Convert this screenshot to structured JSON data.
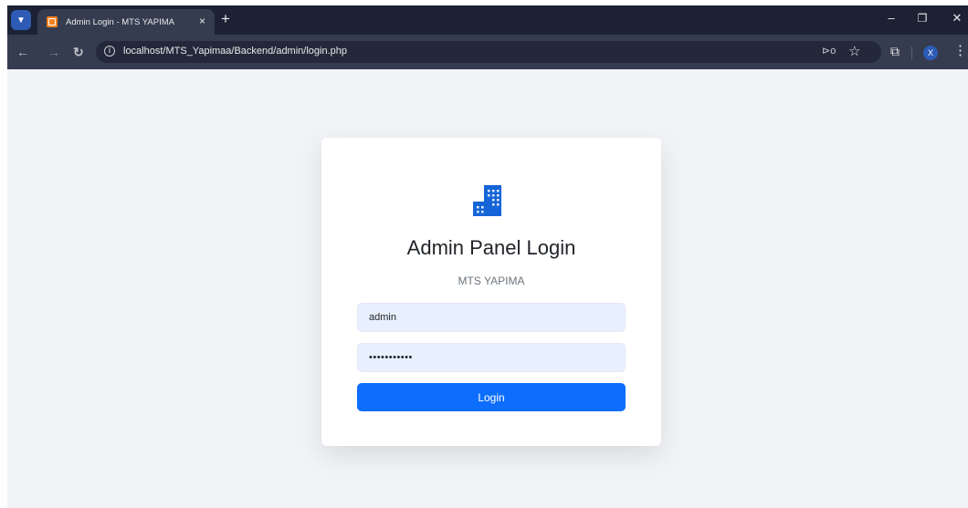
{
  "browser": {
    "tab_title": "Admin Login - MTS YAPIMA",
    "tab_close": "×",
    "new_tab": "+",
    "url": "localhost/MTS_Yapimaa/Backend/admin/login.php",
    "profile_initial": "X",
    "window_controls": {
      "minimize": "–",
      "maximize": "❐",
      "close": "✕"
    },
    "icons": [
      "tab-search-icon",
      "favicon-icon",
      "back-icon",
      "forward-icon",
      "reload-icon",
      "site-info-icon",
      "password-key-icon",
      "bookmark-star-icon",
      "extensions-icon",
      "menu-icon"
    ]
  },
  "login": {
    "heading": "Admin Panel Login",
    "subheading": "MTS YAPIMA",
    "username_value": "admin",
    "password_value": "admin123456",
    "button_label": "Login",
    "logo_icon": "building-icon"
  },
  "colors": {
    "primary": "#0d6efd",
    "page_bg": "#f1f3f6",
    "input_bg": "#e8f0fe",
    "tabbar_bg": "#1c2233",
    "toolbar_bg": "#353c4f"
  }
}
